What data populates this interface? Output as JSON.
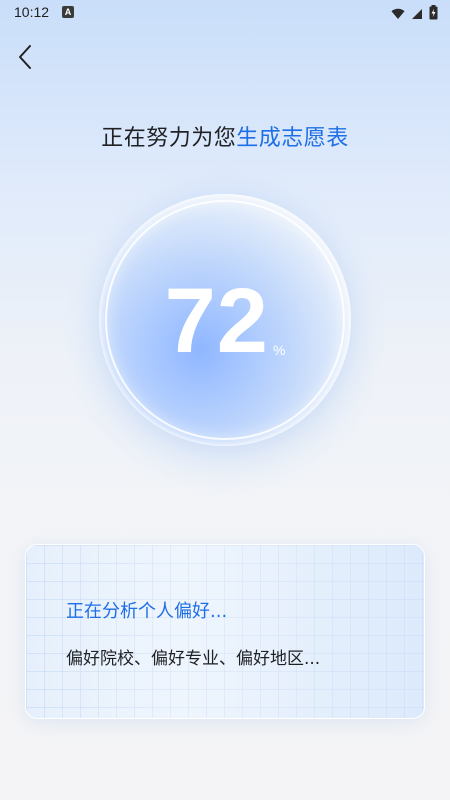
{
  "status_bar": {
    "time": "10:12",
    "notification_icon_letter": "A",
    "icons": [
      "wifi-icon",
      "signal-icon",
      "battery-icon"
    ]
  },
  "header": {
    "back_icon": "chevron-left-icon",
    "title_prefix": "正在努力为您",
    "title_highlight": "生成志愿表"
  },
  "progress": {
    "value": "72",
    "unit": "%",
    "fraction": 0.72
  },
  "info_card": {
    "title": "正在分析个人偏好...",
    "subtitle": "偏好院校、偏好专业、偏好地区..."
  },
  "colors": {
    "accent": "#1e6fe6",
    "text_primary": "#1f2124",
    "orb_core": "#8fb6ff"
  }
}
